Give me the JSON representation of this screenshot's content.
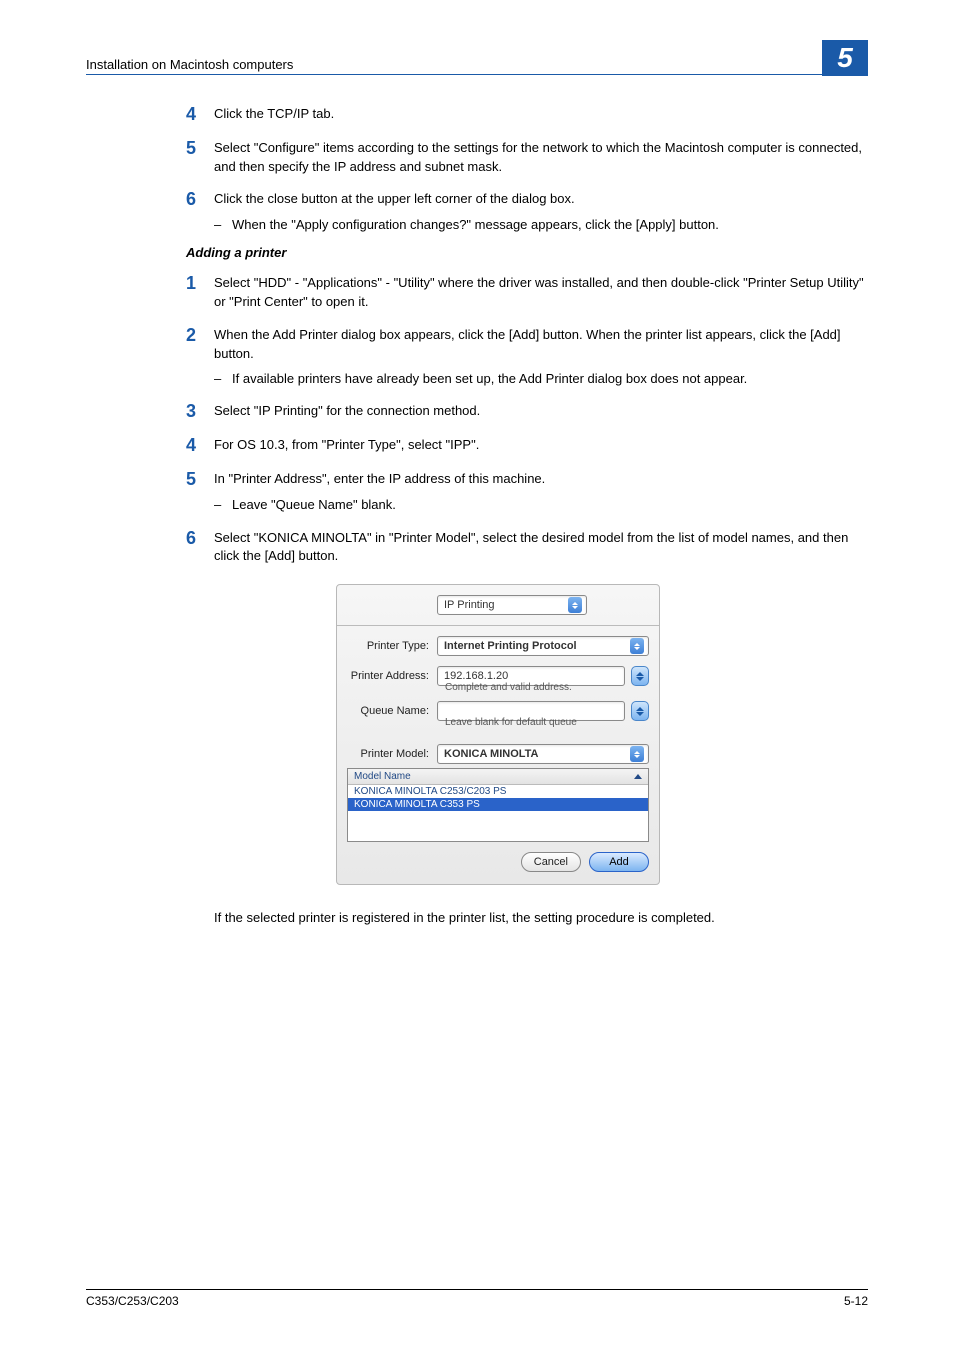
{
  "header": {
    "title": "Installation on Macintosh computers",
    "chapter": "5"
  },
  "stepsA": {
    "s4": "Click the TCP/IP tab.",
    "s5": "Select \"Configure\" items according to the settings for the network to which the Macintosh computer is connected, and then specify the IP address and subnet mask.",
    "s6": "Click the close button at the upper left corner of the dialog box.",
    "s6a": "When the \"Apply configuration changes?\" message appears, click the [Apply] button."
  },
  "subheading": "Adding a printer",
  "stepsB": {
    "s1": "Select \"HDD\" - \"Applications\" - \"Utility\" where the driver was installed, and then double-click \"Printer Setup Utility\" or \"Print Center\" to open it.",
    "s2": "When the Add Printer dialog box appears, click the [Add] button. When the printer list appears, click the [Add] button.",
    "s2a": "If available printers have already been set up, the Add Printer dialog box does not appear.",
    "s3": "Select \"IP Printing\" for the connection method.",
    "s4": "For OS 10.3, from \"Printer Type\", select \"IPP\".",
    "s5": "In \"Printer Address\", enter the IP address of this machine.",
    "s5a": "Leave \"Queue Name\" blank.",
    "s6": "Select \"KONICA MINOLTA\" in \"Printer Model\", select the desired model from the list of model names, and then click the [Add] button."
  },
  "dialog": {
    "method": "IP Printing",
    "labels": {
      "printerType": "Printer Type:",
      "printerAddress": "Printer Address:",
      "queueName": "Queue Name:",
      "printerModel": "Printer Model:",
      "modelName": "Model Name"
    },
    "printerType": "Internet Printing Protocol",
    "printerAddress": "192.168.1.20",
    "addressHelper": "Complete and valid address.",
    "queueName": "",
    "queueHelper": "Leave blank for default queue",
    "printerModel": "KONICA MINOLTA",
    "models": {
      "r1": "KONICA MINOLTA C253/C203 PS",
      "r2": "KONICA MINOLTA C353 PS"
    },
    "cancel": "Cancel",
    "add": "Add"
  },
  "closing": "If the selected printer is registered in the printer list, the setting procedure is completed.",
  "footer": {
    "left": "C353/C253/C203",
    "right": "5-12"
  }
}
